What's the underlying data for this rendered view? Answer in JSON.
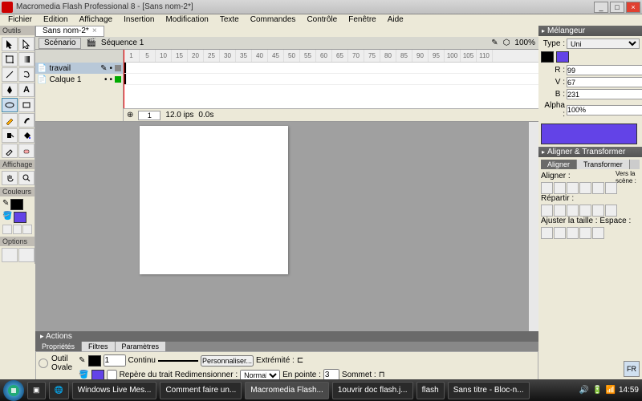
{
  "titlebar": {
    "text": "Macromedia Flash Professional 8 - [Sans nom-2*]"
  },
  "menu": [
    "Fichier",
    "Edition",
    "Affichage",
    "Insertion",
    "Modification",
    "Texte",
    "Commandes",
    "Contrôle",
    "Fenêtre",
    "Aide"
  ],
  "doc_tab": {
    "label": "Sans nom-2*"
  },
  "scene": {
    "button": "Scénario",
    "name": "Séquence 1",
    "zoom": "100%"
  },
  "layers": [
    {
      "name": "travail",
      "selected": true
    },
    {
      "name": "Calque 1",
      "selected": false
    }
  ],
  "timeline_ruler": [
    "1",
    "5",
    "10",
    "15",
    "20",
    "25",
    "30",
    "35",
    "40",
    "45",
    "50",
    "55",
    "60",
    "65",
    "70",
    "75",
    "80",
    "85",
    "90",
    "95",
    "100",
    "105",
    "110"
  ],
  "tlfoot": {
    "frame": "1",
    "fps": "12.0 ips",
    "secs": "0.0s"
  },
  "tool_sections": {
    "outils": "Outils",
    "affichage": "Affichage",
    "couleurs": "Couleurs",
    "options": "Options"
  },
  "mixer": {
    "title": "Mélangeur",
    "type_label": "Type :",
    "type_value": "Uni",
    "r_label": "R :",
    "r": "99",
    "v_label": "V :",
    "v": "67",
    "b_label": "B :",
    "b": "231",
    "alpha_label": "Alpha :",
    "alpha": "100%",
    "hex": "#6343E7",
    "swatch_color": "#6343E7"
  },
  "align": {
    "title": "Aligner & Transformer",
    "tab_align": "Aligner",
    "tab_transform": "Transformer",
    "aligner": "Aligner :",
    "repartir": "Répartir :",
    "ajuster": "Ajuster la taille :",
    "espace": "Espace :",
    "scene": "Vers la scène :"
  },
  "actions": {
    "title": "Actions"
  },
  "props": {
    "tab_prop": "Propriétés",
    "tab_filtres": "Filtres",
    "tab_param": "Paramètres",
    "tool_label": "Outil",
    "tool_name": "Ovale",
    "stroke_w": "1",
    "continu": "Continu",
    "custom": "Personnaliser...",
    "extremite": "Extrémité :",
    "sommet": "Sommet :",
    "repere": "Repère du trait",
    "redim": "Redimensionner :",
    "redim_val": "Normales",
    "pointe": "En pointe :",
    "pointe_val": "3"
  },
  "taskbar": {
    "items": [
      "Windows Live Mes...",
      "Comment faire un...",
      "Macromedia Flash...",
      "1ouvrir doc flash.j...",
      "flash",
      "Sans titre - Bloc-n..."
    ],
    "time": "14:59",
    "lang": "FR"
  }
}
